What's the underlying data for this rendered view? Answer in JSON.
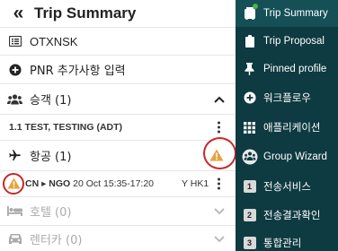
{
  "header": {
    "back_icon": "double-chevron-left-icon",
    "title": "Trip Summary"
  },
  "pnr": {
    "record_locator": "OTXNSK"
  },
  "add_remarks": {
    "label": "PNR 추가사항 입력"
  },
  "passengers": {
    "label": "승객 (1)",
    "items": [
      {
        "index": "1.1",
        "name": "TEST, TESTING (ADT)"
      }
    ]
  },
  "air": {
    "label": "항공 (1)",
    "segments": [
      {
        "route": "CN ▸ NGO",
        "datetime": "20 Oct 15:35-17:20",
        "status": "Y HK1"
      }
    ]
  },
  "hotel": {
    "label": "호텔 (0)"
  },
  "car": {
    "label": "렌터카 (0)"
  },
  "nav": {
    "items": [
      {
        "label": "Trip Summary",
        "icon": "trip-summary-icon",
        "active": true
      },
      {
        "label": "Trip Proposal",
        "icon": "clipboard-icon"
      },
      {
        "label": "Pinned profile",
        "icon": "pin-icon"
      },
      {
        "label": "워크플로우",
        "icon": "plus-circle-icon"
      },
      {
        "label": "애플리케이션",
        "icon": "grid-icon"
      },
      {
        "label": "Group Wizard",
        "icon": "group-wizard-icon"
      },
      {
        "label": "전송서비스",
        "icon": "number-1-icon",
        "number": "1"
      },
      {
        "label": "전송결과확인",
        "icon": "number-2-icon",
        "number": "2"
      },
      {
        "label": "통합관리",
        "icon": "number-3-icon",
        "number": "3"
      }
    ]
  },
  "colors": {
    "nav_bg": "#0e3a41",
    "nav_active": "#155057",
    "warning": "#e6a23c",
    "highlight_circle": "#c62828"
  }
}
